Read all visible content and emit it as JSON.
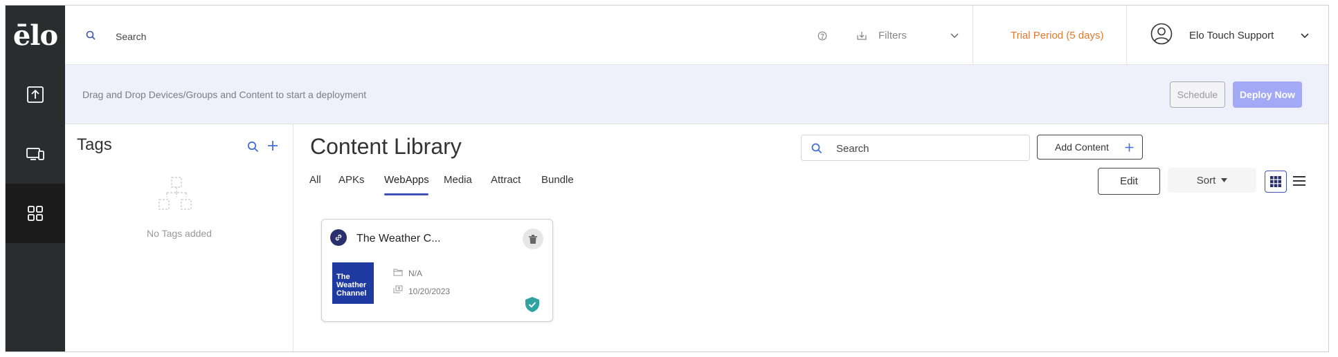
{
  "brand": {
    "logo_text": "ēlo"
  },
  "sidebar": {
    "items": [
      {
        "name": "deploy",
        "icon": "upload-icon",
        "active": false
      },
      {
        "name": "devices",
        "icon": "devices-icon",
        "active": false
      },
      {
        "name": "content",
        "icon": "grid-apps-icon",
        "active": true
      }
    ]
  },
  "topbar": {
    "search_placeholder": "Search",
    "filters_label": "Filters",
    "trial_text": "Trial Period (5 days)",
    "user_name": "Elo Touch Support"
  },
  "deploybar": {
    "hint": "Drag and Drop Devices/Groups and Content to start a deployment",
    "schedule_label": "Schedule",
    "deploy_label": "Deploy Now"
  },
  "tags": {
    "title": "Tags",
    "empty_text": "No Tags added"
  },
  "library": {
    "title": "Content Library",
    "search_placeholder": "Search",
    "add_content_label": "Add Content",
    "tabs": [
      {
        "label": "All",
        "active": false
      },
      {
        "label": "APKs",
        "active": false
      },
      {
        "label": "WebApps",
        "active": true
      },
      {
        "label": "Media",
        "active": false
      },
      {
        "label": "Attract",
        "active": false
      },
      {
        "label": "Bundle",
        "active": false
      }
    ],
    "edit_label": "Edit",
    "sort_label": "Sort",
    "view_mode": "grid",
    "cards": [
      {
        "title": "The Weather C...",
        "thumbnail_text": [
          "The",
          "Weather",
          "Channel"
        ],
        "folder": "N/A",
        "upload_date": "10/20/2023",
        "verified": true
      }
    ]
  },
  "colors": {
    "sidebar_bg": "#2b2c2e",
    "accent": "#3f51b5",
    "trial": "#e07a30",
    "deploy_button": "#a3a9f5",
    "deploy_bar_bg": "#eef0fb",
    "verified": "#2fa3a0",
    "thumbnail_bg": "#1f3aa0"
  }
}
